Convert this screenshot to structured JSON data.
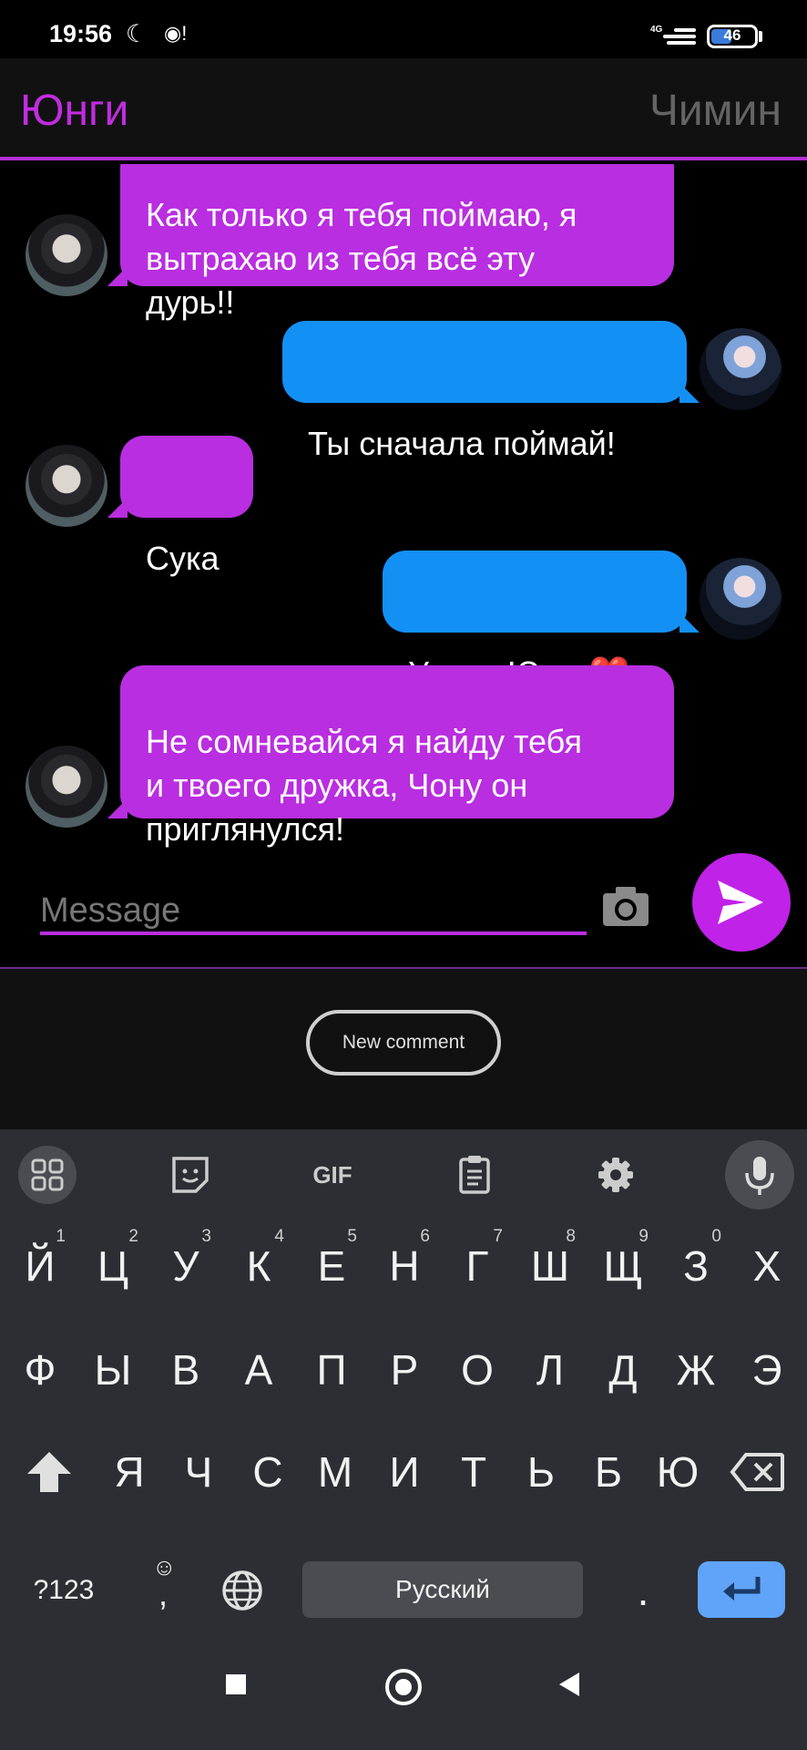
{
  "status_bar": {
    "time": "19:56",
    "network": "4G",
    "battery": "46"
  },
  "tabs": {
    "left": "Юнги",
    "right": "Чимин"
  },
  "messages": [
    {
      "sender": "Юнги",
      "text": "Как только я тебя поймаю, я\nвытрахаю из тебя всё эту\nдурь!!"
    },
    {
      "sender": "Чимин",
      "text": "Ты сначала поймай!"
    },
    {
      "sender": "Юнги",
      "text": "Сука"
    },
    {
      "sender": "Чимин",
      "text": "Удачи Юнги❤️"
    },
    {
      "sender": "Юнги",
      "text": "Не сомневайся я найду тебя\nи твоего дружка, Чону он\nприглянулся!"
    }
  ],
  "composer": {
    "placeholder": "Message"
  },
  "new_comment_label": "New comment",
  "keyboard": {
    "toolbar": [
      "apps-grid-icon",
      "sticker-icon",
      "GIF",
      "clipboard-icon",
      "settings-gear-icon",
      "microphone-icon"
    ],
    "row1": [
      "Й",
      "Ц",
      "У",
      "К",
      "Е",
      "Н",
      "Г",
      "Ш",
      "Щ",
      "З",
      "Х"
    ],
    "row1_hints": [
      "1",
      "2",
      "3",
      "4",
      "5",
      "6",
      "7",
      "8",
      "9",
      "0"
    ],
    "row2": [
      "Ф",
      "Ы",
      "В",
      "А",
      "П",
      "Р",
      "О",
      "Л",
      "Д",
      "Ж",
      "Э"
    ],
    "row3": [
      "Я",
      "Ч",
      "С",
      "М",
      "И",
      "Т",
      "Ь",
      "Б",
      "Ю"
    ],
    "symbols_label": "?123",
    "comma_label": ",",
    "space_label": "Русский",
    "period_label": "."
  },
  "colors": {
    "accent_purple": "#b92ee0",
    "bubble_blue": "#1390f4",
    "enter_blue": "#5fa4f8"
  }
}
